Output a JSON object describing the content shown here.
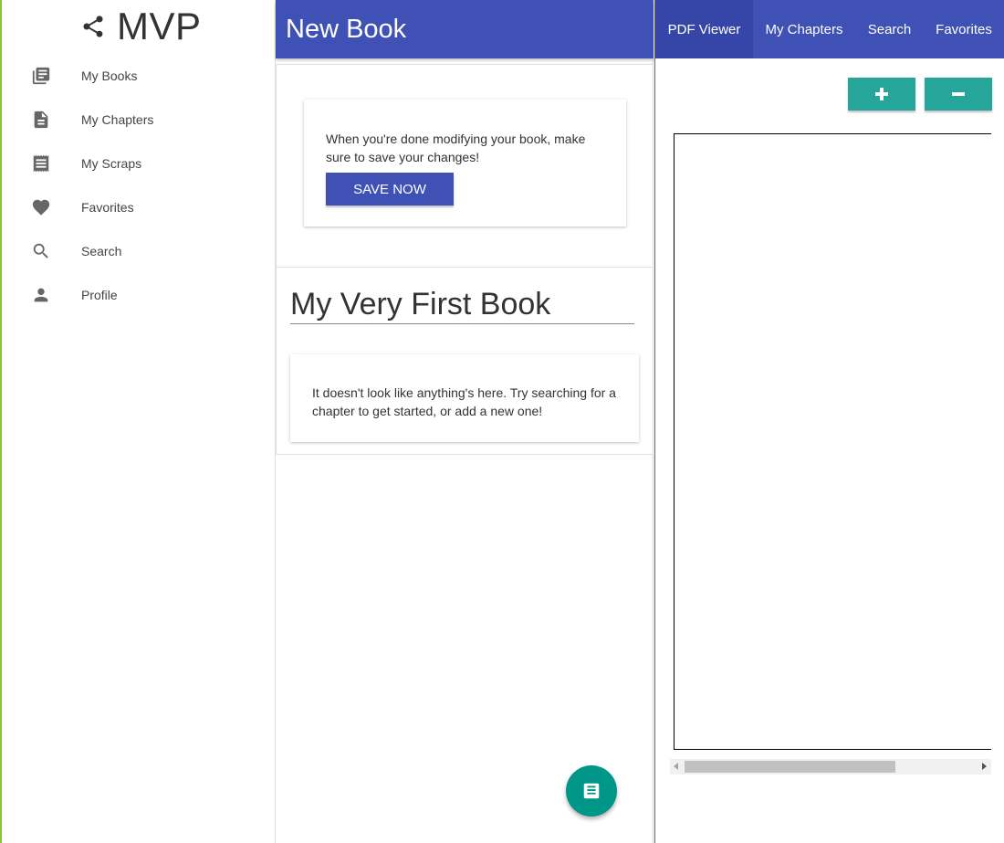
{
  "sidebar": {
    "brand": {
      "icon": "share-icon",
      "title": "MVP"
    },
    "items": [
      {
        "icon": "library-books-icon",
        "label": "My Books"
      },
      {
        "icon": "description-icon",
        "label": "My Chapters"
      },
      {
        "icon": "receipt-icon",
        "label": "My Scraps"
      },
      {
        "icon": "heart-icon",
        "label": "Favorites"
      },
      {
        "icon": "search-icon",
        "label": "Search"
      },
      {
        "icon": "person-icon",
        "label": "Profile"
      }
    ]
  },
  "editor": {
    "title": "New Book",
    "save_card": {
      "message": "When you're done modifying your book, make sure to save your changes!",
      "button_label": "SAVE NOW"
    },
    "book_title": "My Very First Book",
    "empty_message": "It doesn't look like anything's here. Try searching for a chapter to get started, or add a new one!",
    "fab_icon": "new-chapter-icon"
  },
  "viewer_panel": {
    "tabs": [
      {
        "label": "PDF Viewer",
        "active": true
      },
      {
        "label": "My Chapters",
        "active": false
      },
      {
        "label": "Search",
        "active": false
      },
      {
        "label": "Favorites",
        "active": false
      }
    ],
    "zoom_in_icon": "plus-icon",
    "zoom_out_icon": "minus-icon"
  },
  "colors": {
    "primary": "#3f51b5",
    "accent": "#009688",
    "zoom_buttons": "#26a69a",
    "sidebar_left_border": "#8bc34a"
  }
}
